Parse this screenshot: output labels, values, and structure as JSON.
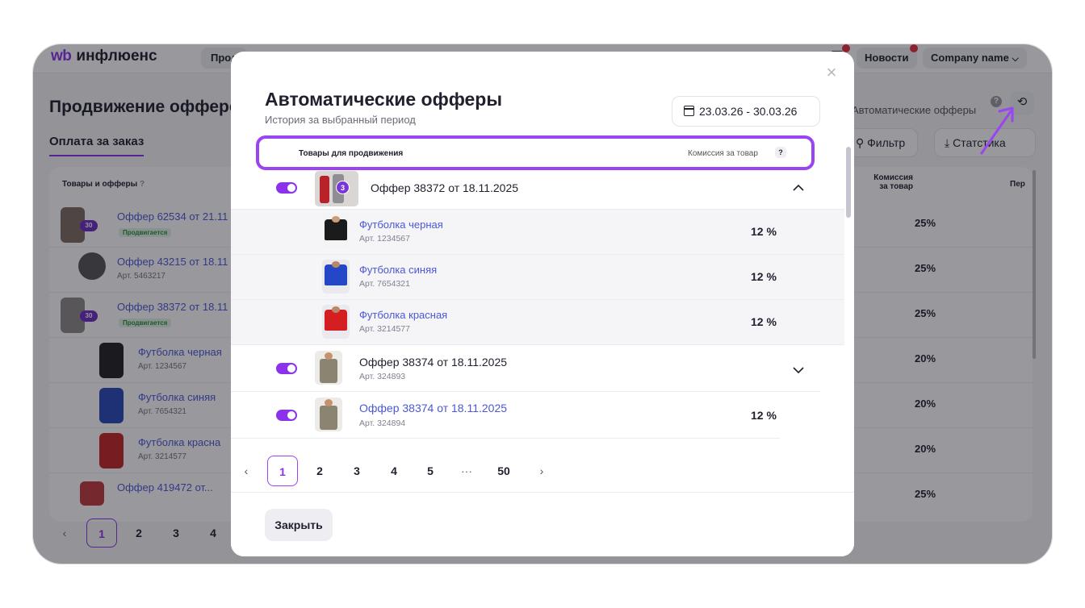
{
  "app": {
    "logo_mark": "wb",
    "logo_text": "инфлюенс",
    "top_tab": "Прод",
    "news": "Новости",
    "company": "Company name",
    "page_title": "Продвижение офферо",
    "tab_order": "Оплата за заказ",
    "auto_offers_link": "Автоматические офферы",
    "filter_label": "Фильтр",
    "stats_label": "Стат",
    "stats_label_tail": "стика",
    "table": {
      "col_goods": "Товары и офферы",
      "col_commission": "Комиссия за товар",
      "col_per": "Пер",
      "help": "?"
    },
    "rows": [
      {
        "name": "Оффер 62534 от 21.11",
        "badge": "Продвигается",
        "count": "30",
        "pct": "25%"
      },
      {
        "name": "Оффер 43215 от 18.11",
        "art": "Арт. 5463217",
        "pct": "25%"
      },
      {
        "name": "Оффер 38372 от 18.11",
        "badge": "Продвигается",
        "count": "30",
        "pct": "25%"
      },
      {
        "name": "Футболка черная",
        "art": "Арт. 1234567",
        "pct": "20%"
      },
      {
        "name": "Футболка синяя",
        "art": "Арт. 7654321",
        "pct": "20%"
      },
      {
        "name": "Футболка красна",
        "art": "Арт. 3214577",
        "pct": "20%"
      },
      {
        "name": "Оффер 419472 от...",
        "pct": "25%"
      }
    ],
    "pager": [
      "1",
      "2",
      "3",
      "4"
    ],
    "pager_prev": "‹"
  },
  "modal": {
    "title": "Автоматические офферы",
    "subtitle": "История за выбранный период",
    "date_range": "23.03.26 - 30.03.26",
    "close_icon": "×",
    "col_goods": "Товары для продвижения",
    "col_commission": "Комиссия за товар",
    "help": "?",
    "group1": {
      "name": "Оффер 38372 от 18.11.2025",
      "count": "3"
    },
    "items": [
      {
        "name": "Футболка черная",
        "art": "Арт. 1234567",
        "pct": "12 %"
      },
      {
        "name": "Футболка синяя",
        "art": "Арт. 7654321",
        "pct": "12 %"
      },
      {
        "name": "Футболка красная",
        "art": "Арт. 3214577",
        "pct": "12 %"
      }
    ],
    "group2": {
      "name": "Оффер 38374 от 18.11.2025",
      "art": "Арт. 324893"
    },
    "row3": {
      "name": "Оффер 38374 от 18.11.2025",
      "art": "Арт. 324894",
      "pct": "12 %"
    },
    "pager": {
      "prev": "‹",
      "pages": [
        "1",
        "2",
        "3",
        "4",
        "5",
        "···",
        "50"
      ],
      "next": "›"
    },
    "close_button": "Закрыть"
  },
  "colors": {
    "accent": "#8b33ea",
    "link": "#4b57d6",
    "highlight": "#9b45f2"
  }
}
